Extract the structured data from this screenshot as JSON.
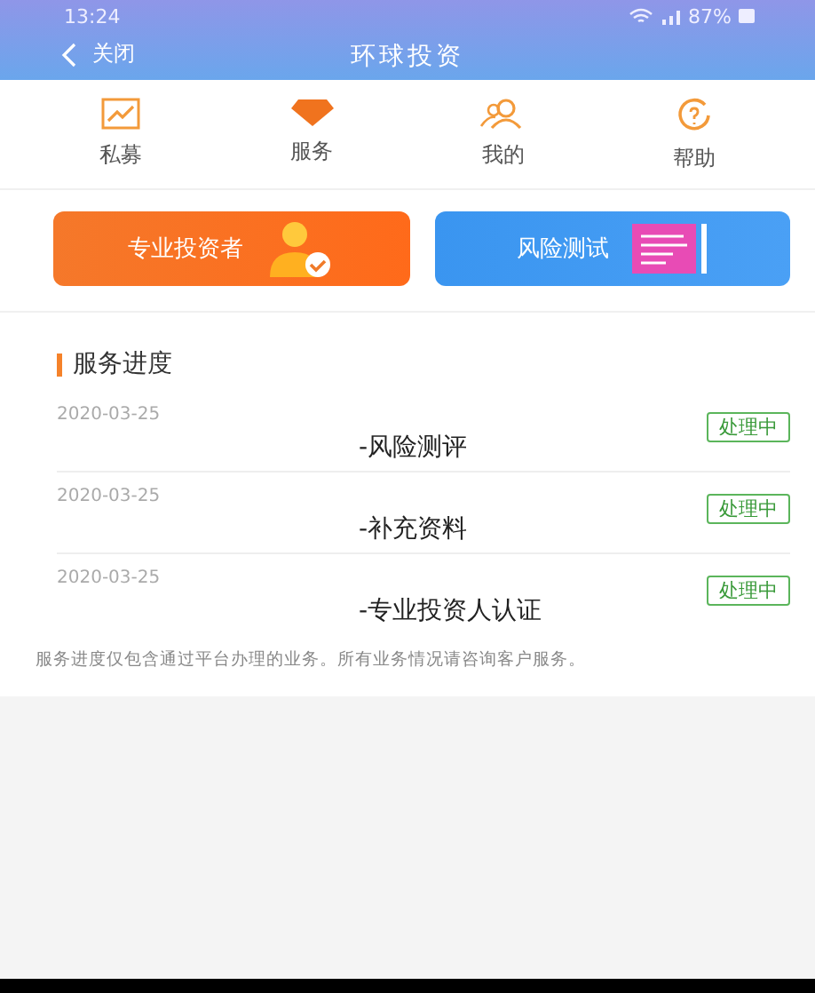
{
  "status_bar": {
    "time": "13:24",
    "battery": "87%"
  },
  "nav": {
    "back": "关闭",
    "title": "环球投资"
  },
  "menu": [
    {
      "kind": "chart",
      "label": "私募"
    },
    {
      "kind": "diamond",
      "label": "服务"
    },
    {
      "kind": "people",
      "label": "我的"
    },
    {
      "kind": "help",
      "label": "帮助"
    }
  ],
  "cards": [
    {
      "kind": "investor",
      "label": "专业投资者"
    },
    {
      "kind": "test",
      "label": "风险测试"
    }
  ],
  "section": {
    "title": "服务进度"
  },
  "progress": [
    {
      "date": "2020-03-25",
      "name": "-风险测评",
      "status": "处理中"
    },
    {
      "date": "2020-03-25",
      "name": "-补充资料",
      "status": "处理中"
    },
    {
      "date": "2020-03-25",
      "name": "-专业投资人认证",
      "status": "处理中"
    }
  ],
  "note": "服务进度仅包含通过平台办理的业务。所有业务情况请咨询客户服务。"
}
